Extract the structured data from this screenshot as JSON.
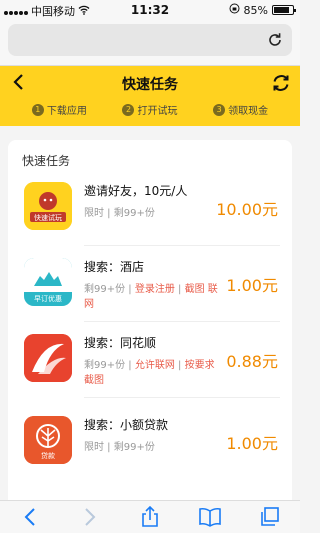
{
  "status_bar": {
    "carrier": "中国移动",
    "time": "11:32",
    "battery": "85%",
    "battery_level": 0.85
  },
  "header": {
    "title": "快速任务",
    "steps": [
      {
        "num": "1",
        "label": "下载应用"
      },
      {
        "num": "2",
        "label": "打开试玩"
      },
      {
        "num": "3",
        "label": "领取现金"
      }
    ]
  },
  "card": {
    "title": "快速任务",
    "tasks": [
      {
        "name": "邀请好友，10元/人",
        "meta_parts": [
          "限时",
          "剩99+份"
        ],
        "reward": "10.00元",
        "icon_text": "快速试玩"
      },
      {
        "name": "搜索：酒店",
        "meta_parts": [
          "剩99+份",
          "登录注册",
          "截图",
          "联网"
        ],
        "reward": "1.00元",
        "icon_text": "早订优惠"
      },
      {
        "name": "搜索：同花顺",
        "meta_parts": [
          "剩99+份",
          "允许联网",
          "按要求截图"
        ],
        "reward": "0.88元",
        "icon_text": ""
      },
      {
        "name": "搜索：小额贷款",
        "meta_parts": [
          "限时",
          "剩99+份"
        ],
        "reward": "1.00元",
        "icon_text": "贷款"
      }
    ]
  },
  "colors": {
    "accent": "#ffd21f",
    "reward": "#f08a00",
    "highlight": "#e85c4a"
  }
}
